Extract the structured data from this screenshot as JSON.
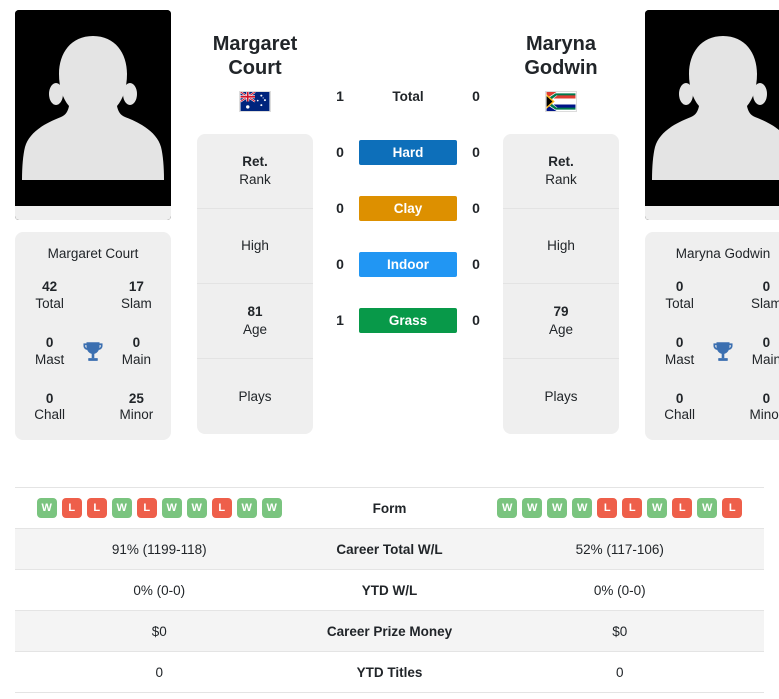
{
  "players": {
    "left": {
      "first_name": "Margaret",
      "last_name": "Court",
      "full_name": "Margaret Court",
      "country": "Australia",
      "flag_icon": "flag-australia-icon",
      "avatar_icon": "player-silhouette-icon",
      "info": [
        {
          "value": "Ret.",
          "label": "Rank"
        },
        {
          "value": "",
          "label": "High"
        },
        {
          "value": "81",
          "label": "Age"
        },
        {
          "value": "",
          "label": "Plays"
        }
      ],
      "titles": [
        {
          "value": "42",
          "label": "Total"
        },
        {
          "value": "17",
          "label": "Slam"
        },
        {
          "value": "0",
          "label": "Mast"
        },
        {
          "value": "0",
          "label": "Main"
        },
        {
          "value": "0",
          "label": "Chall"
        },
        {
          "value": "25",
          "label": "Minor"
        }
      ],
      "form": [
        "W",
        "L",
        "L",
        "W",
        "L",
        "W",
        "W",
        "L",
        "W",
        "W"
      ],
      "career_total_wl": "91% (1199-118)",
      "ytd_wl": "0% (0-0)",
      "career_prize_money": "$0",
      "ytd_titles": "0"
    },
    "right": {
      "first_name": "Maryna",
      "last_name": "Godwin",
      "full_name": "Maryna Godwin",
      "country": "South Africa",
      "flag_icon": "flag-south-africa-icon",
      "avatar_icon": "player-silhouette-icon",
      "info": [
        {
          "value": "Ret.",
          "label": "Rank"
        },
        {
          "value": "",
          "label": "High"
        },
        {
          "value": "79",
          "label": "Age"
        },
        {
          "value": "",
          "label": "Plays"
        }
      ],
      "titles": [
        {
          "value": "0",
          "label": "Total"
        },
        {
          "value": "0",
          "label": "Slam"
        },
        {
          "value": "0",
          "label": "Mast"
        },
        {
          "value": "0",
          "label": "Main"
        },
        {
          "value": "0",
          "label": "Chall"
        },
        {
          "value": "0",
          "label": "Minor"
        }
      ],
      "form": [
        "W",
        "W",
        "W",
        "W",
        "L",
        "L",
        "W",
        "L",
        "W",
        "L"
      ],
      "career_total_wl": "52% (117-106)",
      "ytd_wl": "0% (0-0)",
      "career_prize_money": "$0",
      "ytd_titles": "0"
    }
  },
  "trophy_icon": "trophy-icon",
  "head_to_head": [
    {
      "surface": "Total",
      "left": "1",
      "right": "0",
      "chip": false,
      "color": ""
    },
    {
      "surface": "Hard",
      "left": "0",
      "right": "0",
      "chip": true,
      "color": "#0d6fba"
    },
    {
      "surface": "Clay",
      "left": "0",
      "right": "0",
      "chip": true,
      "color": "#dd9000"
    },
    {
      "surface": "Indoor",
      "left": "0",
      "right": "0",
      "chip": true,
      "color": "#2196f3"
    },
    {
      "surface": "Grass",
      "left": "1",
      "right": "0",
      "chip": true,
      "color": "#089949"
    }
  ],
  "comparison_rows": [
    {
      "label": "Form",
      "type": "form"
    },
    {
      "label": "Career Total W/L",
      "type": "text",
      "left": "91% (1199-118)",
      "right": "52% (117-106)"
    },
    {
      "label": "YTD W/L",
      "type": "text",
      "left": "0% (0-0)",
      "right": "0% (0-0)"
    },
    {
      "label": "Career Prize Money",
      "type": "text",
      "left": "$0",
      "right": "$0"
    },
    {
      "label": "YTD Titles",
      "type": "text",
      "left": "0",
      "right": "0"
    }
  ],
  "colors": {
    "hard": "#0d6fba",
    "clay": "#dd9000",
    "indoor": "#2196f3",
    "grass": "#089949",
    "win_badge": "#7ac47f",
    "loss_badge": "#ee5f4a",
    "trophy": "#3b6fb0",
    "card_bg": "#efefef"
  }
}
